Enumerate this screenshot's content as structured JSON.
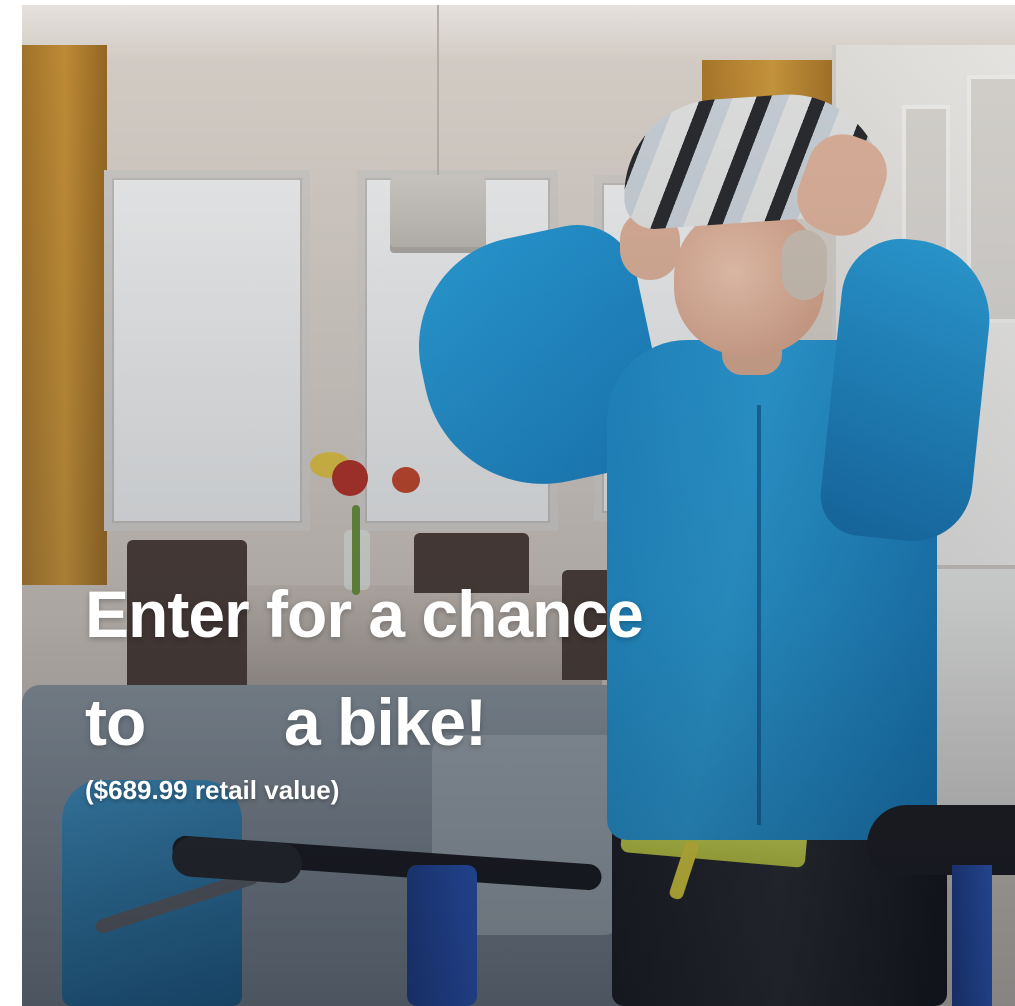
{
  "promo": {
    "headline_line1": "Enter for a chance",
    "headline_line2_start": "to",
    "headline_line2_end": "a bike!",
    "retail_value": "($689.99 retail value)"
  },
  "colors": {
    "headline_text": "#ffffff",
    "jacket": "#1f8cc9",
    "curtain": "#c89236"
  }
}
